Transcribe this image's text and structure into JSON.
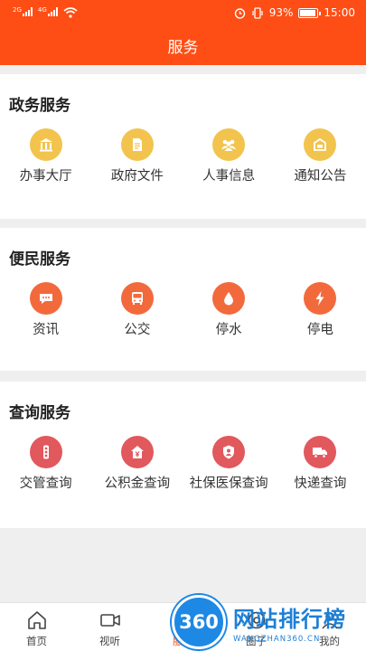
{
  "status_bar": {
    "net1": "2G",
    "net2": "4G",
    "battery_pct": "93%",
    "time": "15:00",
    "battery_level": 0.93
  },
  "header": {
    "title": "服务"
  },
  "sections": [
    {
      "title": "政务服务",
      "items": [
        {
          "label": "办事大厅",
          "icon": "government-hall-icon",
          "color": "#f2c44e"
        },
        {
          "label": "政府文件",
          "icon": "document-icon",
          "color": "#f2c44e"
        },
        {
          "label": "人事信息",
          "icon": "people-icon",
          "color": "#f2c44e"
        },
        {
          "label": "通知公告",
          "icon": "notice-icon",
          "color": "#f2c44e"
        }
      ]
    },
    {
      "title": "便民服务",
      "items": [
        {
          "label": "资讯",
          "icon": "chat-bubble-icon",
          "color": "#f26a3c"
        },
        {
          "label": "公交",
          "icon": "bus-icon",
          "color": "#f26a3c"
        },
        {
          "label": "停水",
          "icon": "water-drop-icon",
          "color": "#f26a3c"
        },
        {
          "label": "停电",
          "icon": "lightning-icon",
          "color": "#f26a3c"
        }
      ]
    },
    {
      "title": "查询服务",
      "items": [
        {
          "label": "交管查询",
          "icon": "traffic-light-icon",
          "color": "#e1585d"
        },
        {
          "label": "公积金查询",
          "icon": "housing-fund-icon",
          "color": "#e1585d"
        },
        {
          "label": "社保医保查询",
          "icon": "shield-person-icon",
          "color": "#e1585d"
        },
        {
          "label": "快递查询",
          "icon": "truck-icon",
          "color": "#e1585d"
        }
      ]
    }
  ],
  "tabbar": {
    "active_color": "#fe4e15",
    "tabs": [
      {
        "label": "首页",
        "icon": "home-icon"
      },
      {
        "label": "视听",
        "icon": "video-icon"
      },
      {
        "label": "服务",
        "icon": "service-icon",
        "active": true
      },
      {
        "label": "圈子",
        "icon": "circle-icon"
      },
      {
        "label": "我的",
        "icon": "user-icon"
      }
    ]
  },
  "watermark": {
    "logo": "360",
    "text_cn": "网站排行榜",
    "text_en": "WANGZHAN360.CN"
  },
  "colors": {
    "header": "#fe4e15",
    "gold": "#f2c44e",
    "orange": "#f26a3c",
    "red": "#e1585d"
  }
}
